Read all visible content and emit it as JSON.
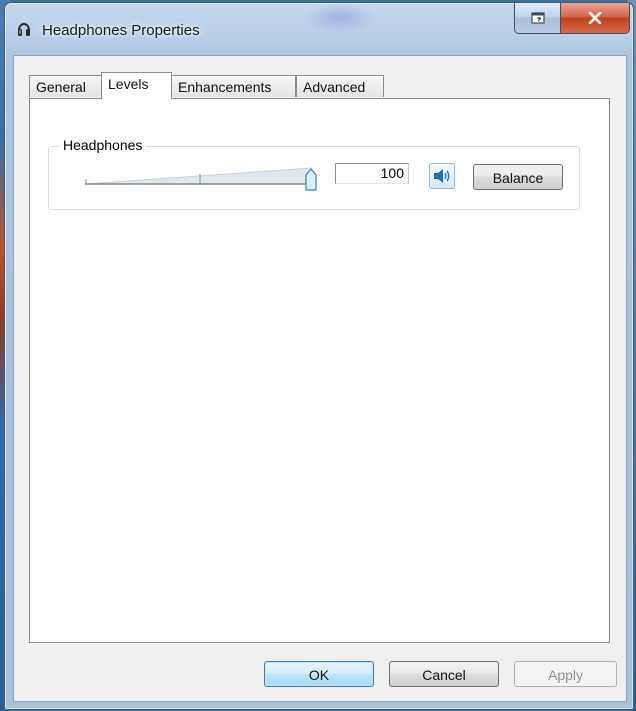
{
  "window": {
    "title": "Headphones Properties"
  },
  "tabs": [
    {
      "label": "General"
    },
    {
      "label": "Levels"
    },
    {
      "label": "Enhancements"
    },
    {
      "label": "Advanced"
    }
  ],
  "active_tab": "Levels",
  "levels": {
    "group_label": "Headphones",
    "volume_value": "100",
    "volume_fraction": 1.0,
    "balance_label": "Balance"
  },
  "footer": {
    "ok_label": "OK",
    "cancel_label": "Cancel",
    "apply_label": "Apply"
  },
  "colors": {
    "close_button": "#c0401f",
    "ok_border": "#3c7fb1",
    "speaker_icon": "#1a6fc4"
  }
}
